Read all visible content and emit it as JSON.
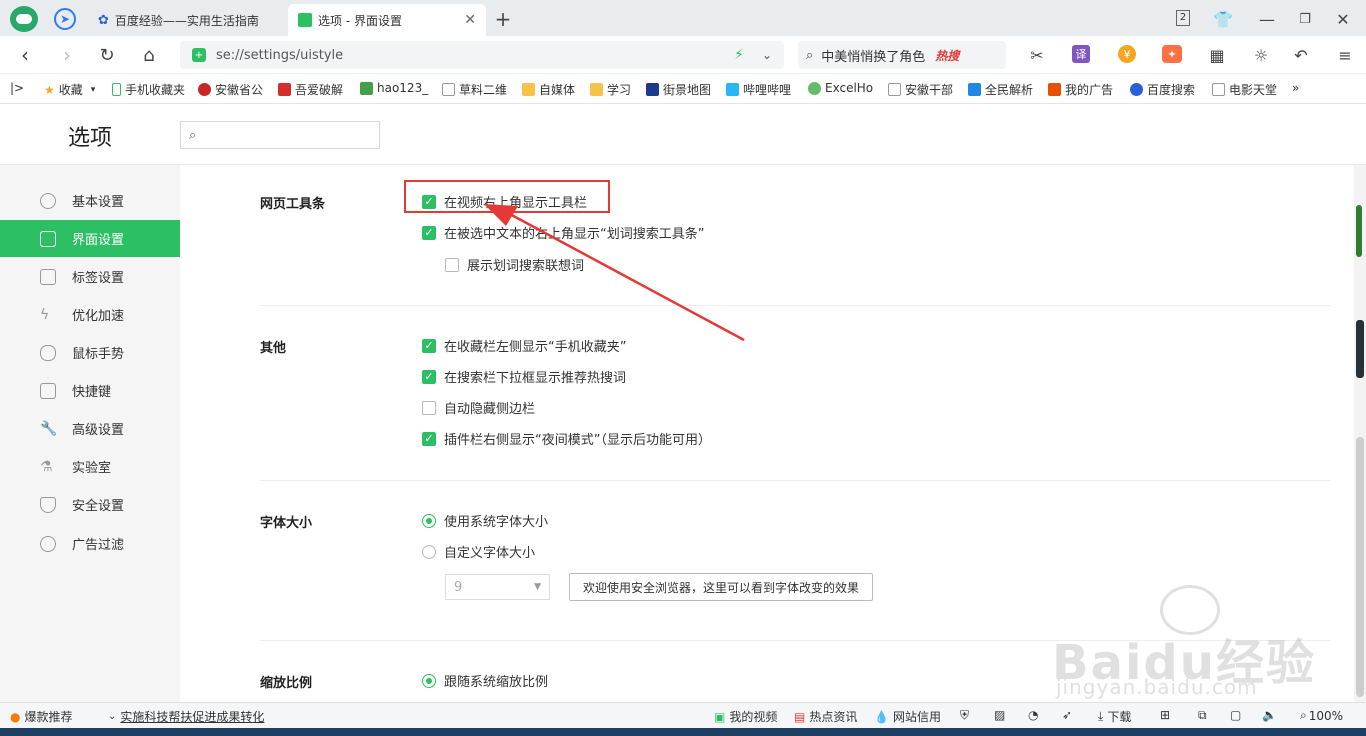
{
  "tabs": [
    {
      "label": "百度经验——实用生活指南"
    },
    {
      "label": "选项 - 界面设置"
    }
  ],
  "tab_counter": "2",
  "address": {
    "url": "se://settings/uistyle"
  },
  "search_box": {
    "text": "中美悄悄换了角色",
    "hot_badge": "热搜"
  },
  "bookmarks": [
    {
      "label": "收藏"
    },
    {
      "label": "手机收藏夹"
    },
    {
      "label": "安徽省公"
    },
    {
      "label": "吾爱破解"
    },
    {
      "label": "hao123_"
    },
    {
      "label": "草料二维"
    },
    {
      "label": "自媒体"
    },
    {
      "label": "学习"
    },
    {
      "label": "街景地图"
    },
    {
      "label": "哔哩哔哩"
    },
    {
      "label": "ExcelHo"
    },
    {
      "label": "安徽干部"
    },
    {
      "label": "全民解析"
    },
    {
      "label": "我的广告"
    },
    {
      "label": "百度搜索"
    },
    {
      "label": "电影天堂"
    }
  ],
  "page_title": "选项",
  "search_placeholder": "",
  "sidebar": [
    {
      "label": "基本设置"
    },
    {
      "label": "界面设置"
    },
    {
      "label": "标签设置"
    },
    {
      "label": "优化加速"
    },
    {
      "label": "鼠标手势"
    },
    {
      "label": "快捷键"
    },
    {
      "label": "高级设置"
    },
    {
      "label": "实验室"
    },
    {
      "label": "安全设置"
    },
    {
      "label": "广告过滤"
    }
  ],
  "sections": {
    "toolbar": {
      "title": "网页工具条",
      "options": [
        {
          "label": "在视频右上角显示工具栏",
          "checked": true
        },
        {
          "label": "在被选中文本的右上角显示“划词搜索工具条”",
          "checked": true
        },
        {
          "label": "展示划词搜索联想词",
          "checked": false
        }
      ]
    },
    "other": {
      "title": "其他",
      "options": [
        {
          "label": "在收藏栏左侧显示“手机收藏夹”",
          "checked": true
        },
        {
          "label": "在搜索栏下拉框显示推荐热搜词",
          "checked": true
        },
        {
          "label": "自动隐藏侧边栏",
          "checked": false
        },
        {
          "label": "插件栏右侧显示“夜间模式”（显示后功能可用）",
          "checked": true
        }
      ]
    },
    "font": {
      "title": "字体大小",
      "options": [
        {
          "label": "使用系统字体大小",
          "selected": true
        },
        {
          "label": "自定义字体大小",
          "selected": false
        }
      ],
      "size_value": "9",
      "preview": "欢迎使用安全浏览器，这里可以看到字体改变的效果"
    },
    "zoom": {
      "title": "缩放比例",
      "options": [
        {
          "label": "跟随系统缩放比例",
          "selected": true
        }
      ]
    }
  },
  "statusbar": {
    "left1": "爆款推荐",
    "left2": "实施科技帮扶促进成果转化",
    "video": "我的视频",
    "news": "热点资讯",
    "credit": "网站信用",
    "download": "下载",
    "zoom": "100%"
  },
  "watermark": {
    "brand": "Baidu经验",
    "url": "jingyan.baidu.com"
  },
  "colors": {
    "accent": "#2dbf64",
    "highlight_box": "#e53935",
    "arrow": "#e53935"
  }
}
